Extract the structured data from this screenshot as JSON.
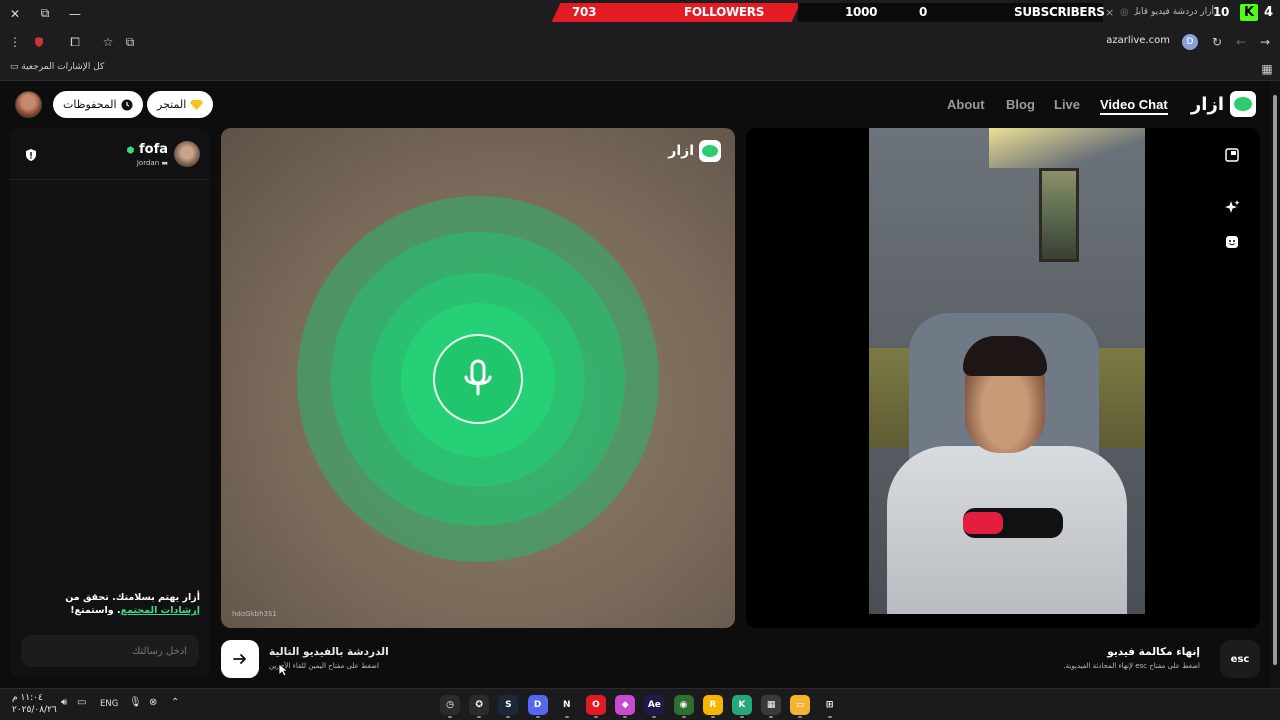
{
  "window": {
    "close": "✕",
    "maximize": "⧉",
    "minimize": "—"
  },
  "overlay": {
    "followers_count": "703",
    "followers_label": "FOLLOWERS",
    "followers_goal": "1000",
    "subscribers_count": "0",
    "subscribers_label": "SUBSCRIBERS",
    "tab_close": "×",
    "tab_title": "أزار دردشة فيديو قابل الأص...",
    "viewer_count": "10",
    "kick_number": "4",
    "kick_logo": "K",
    "accent_red": "#e31b22",
    "kick_green": "#53fc18"
  },
  "browser": {
    "url": "azarlive.com",
    "profile_initial": "D",
    "bookmarks_label": "كل الإشارات المرجعية"
  },
  "header": {
    "brand": "ازار",
    "nav": [
      {
        "label": "About"
      },
      {
        "label": "Blog"
      },
      {
        "label": "Live"
      },
      {
        "label": "Video Chat"
      }
    ],
    "store_label": "المتجر",
    "saved_label": "المحفوظات"
  },
  "chat": {
    "peer_name": "fofa",
    "peer_country": "Jordan",
    "safety_text_before": "أزار يهتم بسلامتك. تحقق من ",
    "safety_link": "إرشادات المجتمع",
    "safety_text_after": ". واستمتع!",
    "input_placeholder": "أدخل رسالتك"
  },
  "remote": {
    "brand": "ازار",
    "user_id": "hdoGkbh3S1",
    "ring_color": "#2bc46d"
  },
  "footer": {
    "next_title": "الدردشة بالفيديو التالية",
    "next_hint": "اضغط على مفتاح اليمين للقاء الآخرين",
    "esc_label": "esc",
    "end_title": "إنهاء مكالمة فيديو",
    "end_hint": "اضغط على مفتاح esc لإنهاء المحادثة الفيديوية."
  },
  "taskbar": {
    "time": "١١:٠٤ م",
    "date": "٢٠٢٥/٠٨/٢٦",
    "lang": "ENG",
    "apps": [
      {
        "name": "clock-app-icon",
        "label": "◷",
        "color": "#2b2b2e"
      },
      {
        "name": "xbox-app-icon",
        "label": "✪",
        "color": "#2b2b2e"
      },
      {
        "name": "steam-app-icon",
        "label": "S",
        "color": "#1b2838"
      },
      {
        "name": "discord-app-icon",
        "label": "D",
        "color": "#5865f2"
      },
      {
        "name": "netflix-app-icon",
        "label": "N",
        "color": "#1b1b1d"
      },
      {
        "name": "opera-app-icon",
        "label": "O",
        "color": "#e01b24"
      },
      {
        "name": "photos-app-icon",
        "label": "◆",
        "color": "#c74ad1"
      },
      {
        "name": "after-effects-app-icon",
        "label": "Ae",
        "color": "#1f1a4a"
      },
      {
        "name": "chrome-app-icon",
        "label": "◉",
        "color": "#2f6f2f"
      },
      {
        "name": "rockstar-app-icon",
        "label": "R",
        "color": "#f7b500"
      },
      {
        "name": "kick-app-icon",
        "label": "K",
        "color": "#27a87a"
      },
      {
        "name": "store-app-icon",
        "label": "▦",
        "color": "#3a3a3d"
      },
      {
        "name": "files-app-icon",
        "label": "▭",
        "color": "#f3b52f"
      },
      {
        "name": "start-app-icon",
        "label": "⊞",
        "color": "#1b1b1d"
      }
    ]
  }
}
